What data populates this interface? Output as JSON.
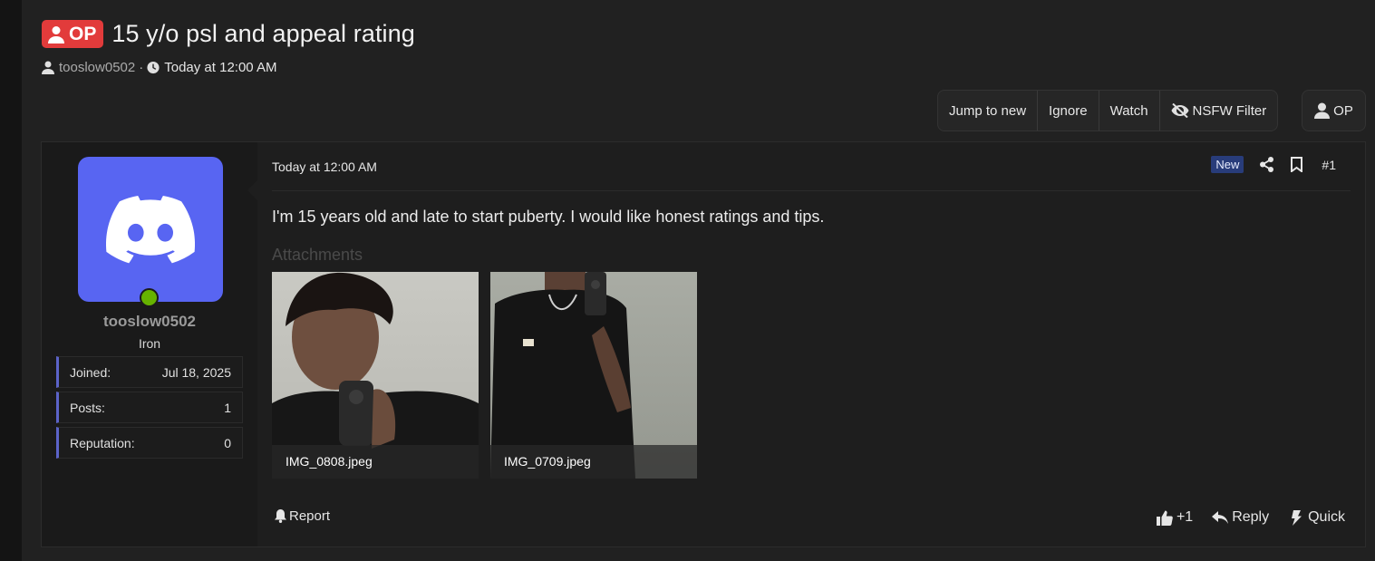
{
  "thread": {
    "op_badge": "OP",
    "title": "15 y/o psl and appeal rating",
    "author": "tooslow0502",
    "separator": "·",
    "date": "Today at 12:00 AM"
  },
  "toolbar": {
    "jump_to_new": "Jump to new",
    "ignore": "Ignore",
    "watch": "Watch",
    "nsfw_filter": "NSFW Filter",
    "op_filter": "OP"
  },
  "user": {
    "username": "tooslow0502",
    "rank": "Iron",
    "online": true,
    "avatar_color": "#5865f2",
    "stats": [
      {
        "label": "Joined:",
        "value": "Jul 18, 2025"
      },
      {
        "label": "Posts:",
        "value": "1"
      },
      {
        "label": "Reputation:",
        "value": "0"
      }
    ]
  },
  "post": {
    "date": "Today at 12:00 AM",
    "new_badge": "New",
    "number": "#1",
    "message": "I'm 15 years old and late to start puberty. I would like honest ratings and tips.",
    "attachments_label": "Attachments",
    "attachments": [
      {
        "name": "IMG_0808.jpeg"
      },
      {
        "name": "IMG_0709.jpeg"
      }
    ],
    "report": "Report",
    "like_count": "+1",
    "reply": "Reply",
    "quick": "Quick"
  },
  "colors": {
    "op_badge": "#e23b3b",
    "new_badge": "#283c7a",
    "stat_accent": "#5b63c8",
    "online": "#66b200"
  }
}
